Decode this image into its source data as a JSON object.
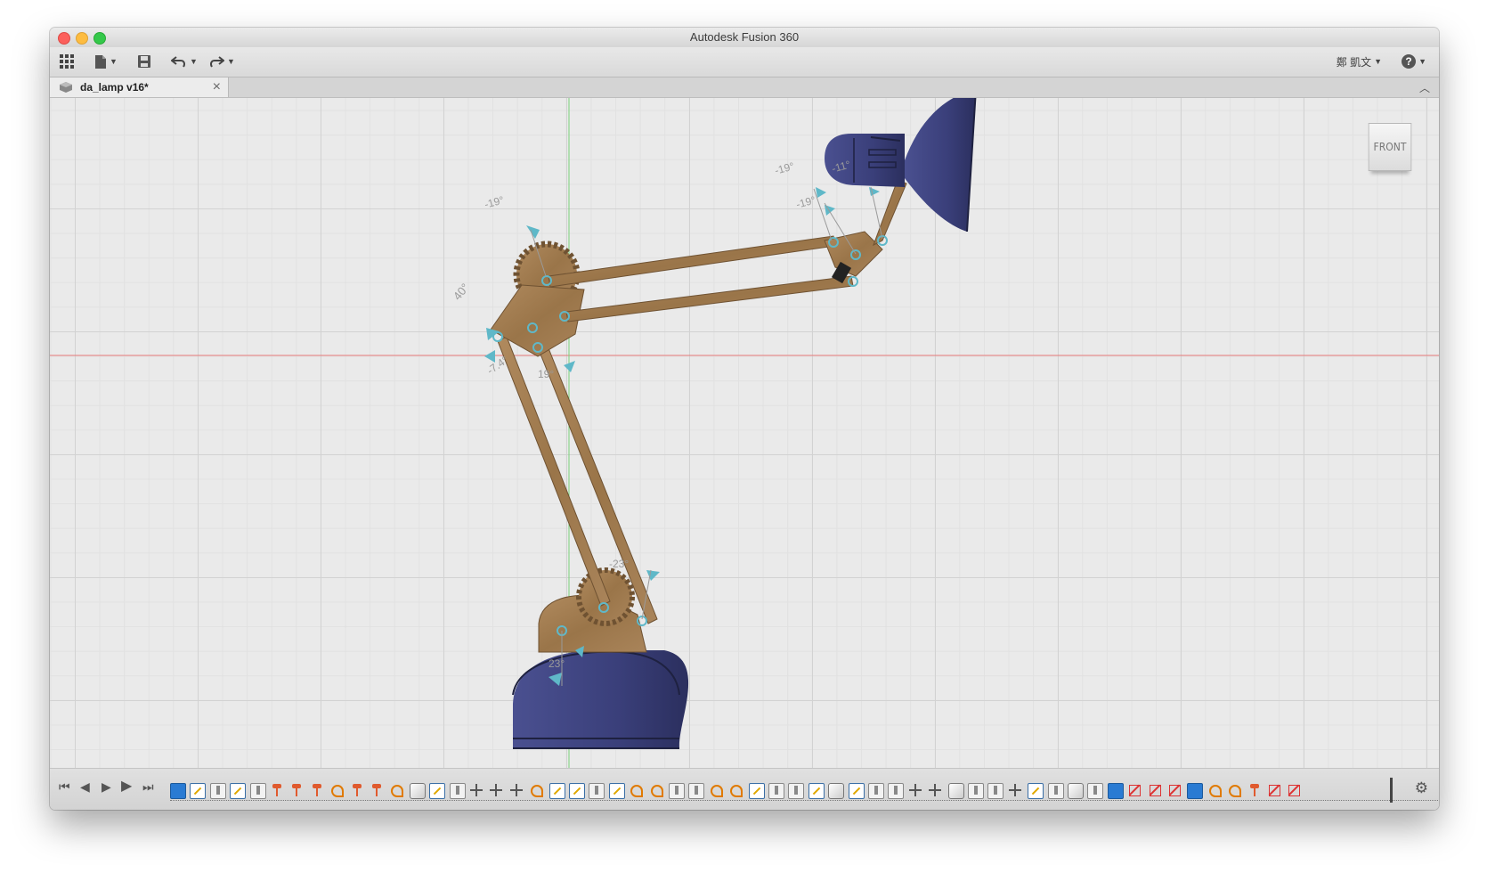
{
  "window": {
    "title": "Autodesk Fusion 360"
  },
  "toolbar": {
    "user_label": "鄭 凱文",
    "help_glyph": "?"
  },
  "tab": {
    "name": "da_lamp v16*",
    "close_glyph": "×"
  },
  "viewcube": {
    "face": "FRONT"
  },
  "joint_labels": {
    "shoulder_top": "-19°",
    "shoulder_left": "40°",
    "shoulder_lower": "19°",
    "shoulder_lower_left": "-7.4°",
    "elbow_a": "-19°",
    "elbow_b": "-19°",
    "elbow_c": "-11°",
    "base_top": "-23°",
    "base_bottom": "23°"
  },
  "colors": {
    "wood": "#a27d52",
    "wood_dark": "#7a5a35",
    "lamp_blue": "#3a3f7a",
    "joint_marker": "#5fb8c8",
    "axis_red": "#e87b7b",
    "axis_green": "#7bd07b"
  },
  "timeline": {
    "features": [
      "shell",
      "sketch",
      "extrude",
      "sketch",
      "extrude",
      "joint",
      "joint",
      "joint",
      "asbuilt",
      "joint",
      "joint",
      "asbuilt",
      "body",
      "sketch",
      "extrude",
      "move",
      "move",
      "move",
      "asbuilt",
      "sketch",
      "sketch",
      "extrude",
      "sketch",
      "asbuilt",
      "asbuilt",
      "extrude",
      "extrude",
      "asbuilt",
      "asbuilt",
      "sketch",
      "extrude",
      "extrude",
      "sketch",
      "body",
      "sketch",
      "extrude",
      "extrude",
      "move",
      "move",
      "body",
      "extrude",
      "extrude",
      "move",
      "sketch",
      "extrude",
      "body",
      "extrude",
      "shell",
      "disabled",
      "disabled",
      "disabled",
      "shell",
      "asbuilt",
      "asbuilt",
      "joint",
      "disabled",
      "disabled"
    ]
  }
}
